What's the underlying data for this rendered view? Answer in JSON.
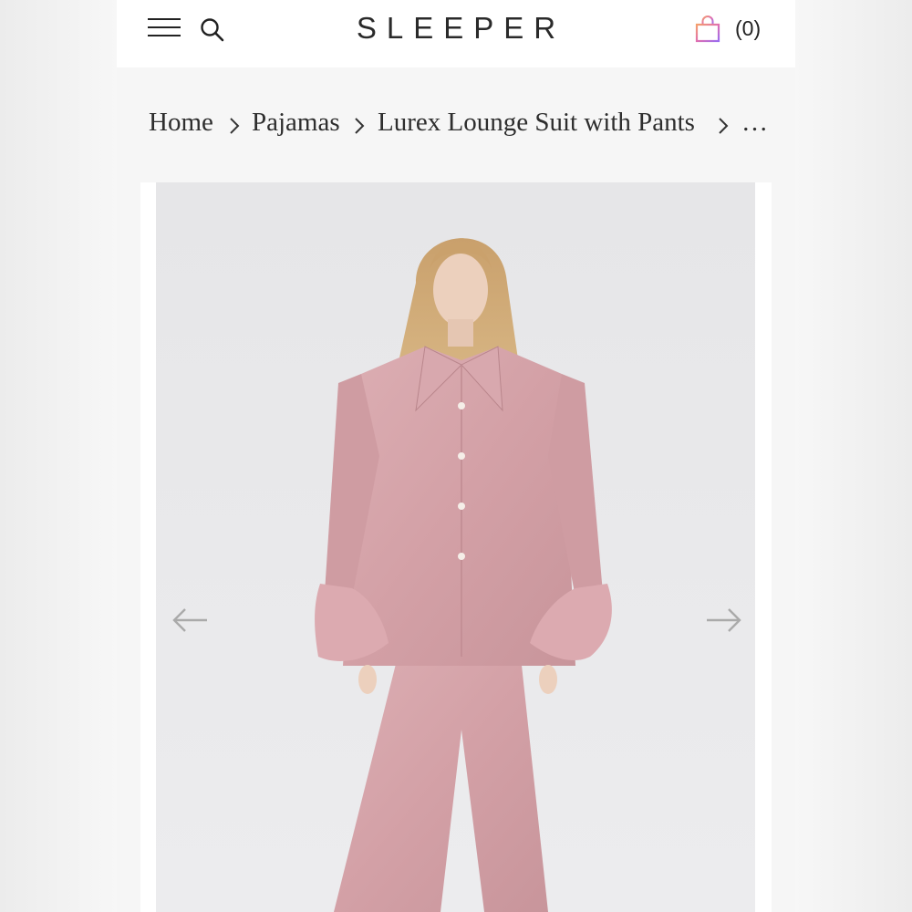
{
  "header": {
    "brand": "SLEEPER",
    "menu_icon": "hamburger-menu-icon",
    "search_icon": "search-icon",
    "cart_icon": "shopping-bag-icon",
    "cart_count": "(0)"
  },
  "breadcrumb": {
    "items": [
      "Home",
      "Pajamas",
      "Lurex Lounge Suit with Pants"
    ],
    "overflow": "…",
    "separator_icon": "chevron-right-icon"
  },
  "gallery": {
    "prev_icon": "arrow-left-icon",
    "next_icon": "arrow-right-icon",
    "image_subject": "model in pink lurex shirt with ruffled cuffs and flared pants"
  },
  "colors": {
    "page_bg": "#f7f7f7",
    "header_bg": "#ffffff",
    "photo_bg": "#e8e8ea",
    "suit_pink": "#d9a7ab",
    "cart_gradient_start": "#f4a06c",
    "cart_gradient_end": "#9a6cf0"
  }
}
